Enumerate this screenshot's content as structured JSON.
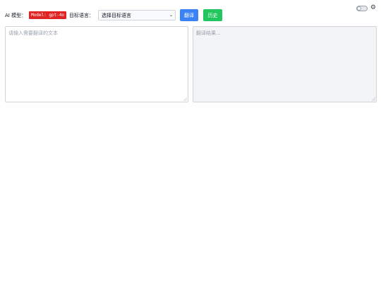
{
  "toolbar": {
    "model_label": "AI 模型：",
    "model_badge": "Model: gpt-4o",
    "target_lang_label": "目标语言：",
    "target_lang_selected": "选择目标语言",
    "translate_button": "翻译",
    "history_button": "历史"
  },
  "input": {
    "placeholder": "请输入需要翻译的文本"
  },
  "output": {
    "placeholder": "翻译结果..."
  },
  "icons": {
    "settings": "gear-icon",
    "theme_toggle": "toggle-switch",
    "select_caret": "chevron-down-icon"
  },
  "colors": {
    "badge": "#e02424",
    "translate": "#3b82f6",
    "history": "#22c55e",
    "output_bg": "#f3f4f6"
  }
}
